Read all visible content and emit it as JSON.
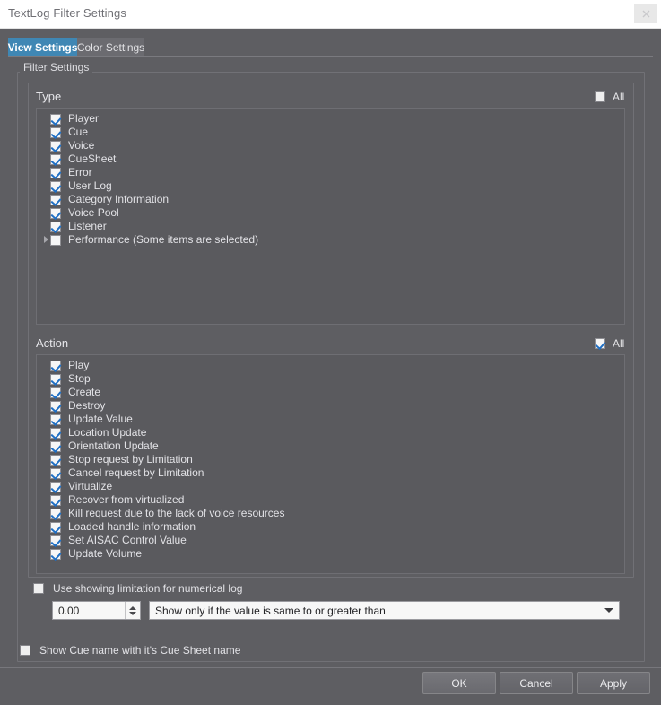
{
  "window": {
    "title": "TextLog Filter Settings",
    "close_icon": "close-icon"
  },
  "tabs": [
    {
      "label": "View Settings",
      "active": true
    },
    {
      "label": "Color Settings",
      "active": false
    }
  ],
  "filter_group": {
    "label": "Filter Settings"
  },
  "type_section": {
    "title": "Type",
    "all_label": "All",
    "all_checked": false,
    "items": [
      {
        "label": "Player",
        "checked": true,
        "expandable": false
      },
      {
        "label": "Cue",
        "checked": true,
        "expandable": false
      },
      {
        "label": "Voice",
        "checked": true,
        "expandable": false
      },
      {
        "label": "CueSheet",
        "checked": true,
        "expandable": false
      },
      {
        "label": "Error",
        "checked": true,
        "expandable": false
      },
      {
        "label": "User Log",
        "checked": true,
        "expandable": false
      },
      {
        "label": "Category Information",
        "checked": true,
        "expandable": false
      },
      {
        "label": "Voice Pool",
        "checked": true,
        "expandable": false
      },
      {
        "label": "Listener",
        "checked": true,
        "expandable": false
      },
      {
        "label": "Performance (Some items are selected)",
        "checked": false,
        "expandable": true
      }
    ]
  },
  "action_section": {
    "title": "Action",
    "all_label": "All",
    "all_checked": true,
    "items": [
      {
        "label": "Play",
        "checked": true,
        "expandable": false
      },
      {
        "label": "Stop",
        "checked": true,
        "expandable": false
      },
      {
        "label": "Create",
        "checked": true,
        "expandable": false
      },
      {
        "label": "Destroy",
        "checked": true,
        "expandable": false
      },
      {
        "label": "Update Value",
        "checked": true,
        "expandable": false
      },
      {
        "label": "Location Update",
        "checked": true,
        "expandable": false
      },
      {
        "label": "Orientation Update",
        "checked": true,
        "expandable": false
      },
      {
        "label": "Stop request by Limitation",
        "checked": true,
        "expandable": false
      },
      {
        "label": "Cancel request by Limitation",
        "checked": true,
        "expandable": false
      },
      {
        "label": "Virtualize",
        "checked": true,
        "expandable": false
      },
      {
        "label": "Recover from virtualized",
        "checked": true,
        "expandable": false
      },
      {
        "label": "Kill request due to the lack of voice resources",
        "checked": true,
        "expandable": false
      },
      {
        "label": "Loaded handle information",
        "checked": true,
        "expandable": false
      },
      {
        "label": "Set AISAC Control Value",
        "checked": true,
        "expandable": false
      },
      {
        "label": "Update Volume",
        "checked": true,
        "expandable": false
      }
    ]
  },
  "numeric_limit": {
    "checkbox_label": "Use showing limitation for numerical log",
    "checked": false,
    "value": "0.00",
    "condition": "Show only if the value is same to or greater than"
  },
  "cue_name_option": {
    "label": "Show Cue name with it's Cue Sheet name",
    "checked": false
  },
  "footer": {
    "ok_label": "OK",
    "cancel_label": "Cancel",
    "apply_label": "Apply"
  },
  "colors": {
    "window_bg": "#5e5e62",
    "titlebar_bg": "#ffffff",
    "active_tab": "#3f87b4",
    "check_blue": "#1f6fc4",
    "text": "#e2e2e6"
  }
}
